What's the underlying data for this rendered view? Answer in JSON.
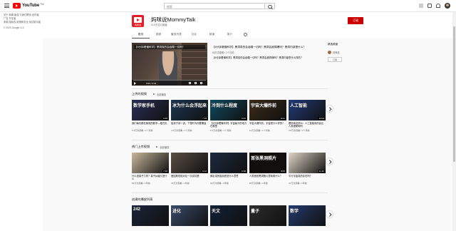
{
  "app": {
    "logo_text": "YouTube",
    "region": "TW"
  },
  "search": {
    "placeholder": "搜索"
  },
  "sidebar": {
    "links_text": "关于 新闻 版权 与我们联系 创作者 广告 开发者",
    "policy_text": "条款 隐私权 政策和安全 测试新功能",
    "copyright": "© 2020 Google LLC"
  },
  "channel": {
    "avatar_sub": "妈咪说",
    "name": "妈咪说MommyTalk",
    "subscribers": "11.5万位订阅者",
    "subscribe_label": "订阅"
  },
  "tabs": [
    "首页",
    "视频",
    "播放列表",
    "社区",
    "频道",
    "简介"
  ],
  "feature": {
    "thumb_title": "【6分钟看懂科学】黑洞真的会吞噬一切吗？",
    "time": "0:00 / 6:24",
    "progress": 0.0,
    "title": "【6分钟看懂科学】黑洞真的会吞噬一切吗？黑洞会被撑爆吗？黑洞内部是什么？",
    "meta": "65万次观看 • 1个月前",
    "desc": "【6分钟看懂科学】黑洞真的会吞噬一切吗？黑洞会被撑爆吗？黑洞内部是什么样的？"
  },
  "shelves": [
    {
      "title": "上传的视频",
      "play_all": "全部播放",
      "videos": [
        {
          "thumb": "数学家手机",
          "duration": "9:48",
          "title": "我们每天都在使用的数学—格式化",
          "meta": "5.4万次观看 • 1个月前",
          "bg": "#2a2f55"
        },
        {
          "thumb": "冰为什么会浮起来",
          "duration": "7:15",
          "title": "给孩子讲一讲，下雪时为何要撒盐",
          "meta": "4.2万次观看 • 1个月前",
          "bg": "#1d3552"
        },
        {
          "thumb": "冷到什么程度",
          "duration": "6:02",
          "title": "【3分钟看懂科学】宇宙最冷的地方在哪里",
          "meta": "6.4万次观看 • 1个月前",
          "bg": "#0e4a5e"
        },
        {
          "thumb": "宇宙大爆炸前",
          "duration": "8:21",
          "title": "宇宙大爆炸前，宇宙是什么样的？",
          "meta": "12万次观看 • 1个月前",
          "bg": "#3b2b18"
        },
        {
          "thumb": "人工智能",
          "duration": "10:04",
          "title": "跟妈咪说学AI：人工智能真的会比人类更聪明吗",
          "meta": "3.8万次观看 • 2个月前",
          "bg": "#223a78"
        }
      ]
    },
    {
      "title": "热门上传视频",
      "play_all": "全部播放",
      "videos": [
        {
          "thumb": "",
          "duration": "7:48",
          "title": "什么是量子力学？量子纠缠又是什么",
          "meta": "89万次观看 • 1年前",
          "bg": "#c9b89c"
        },
        {
          "thumb": "",
          "duration": "9:12",
          "title": "爱因斯坦相对论一次讲清楚",
          "meta": "76万次观看 • 1年前",
          "bg": "#5a4e44"
        },
        {
          "thumb": "",
          "duration": "6:38",
          "title": "薛定谔的猫到底是什么意思",
          "meta": "64万次观看 • 1年前",
          "bg": "#1d2a3f"
        },
        {
          "thumb": "首张黑洞照片",
          "duration": "8:05",
          "title": "人类首张黑洞照片意味着什么？",
          "meta": "58万次观看 • 1年前",
          "bg": "#120c08"
        },
        {
          "thumb": "",
          "duration": "11:20",
          "title": "平行宇宙真的存在吗？",
          "meta": "47万次观看 • 1年前",
          "bg": "#dfd6c7"
        }
      ]
    },
    {
      "title": "创建的播放列表",
      "play_all": "",
      "videos": [
        {
          "thumb": "242",
          "duration": "",
          "title": "",
          "meta": "",
          "bg": "#1a2338"
        },
        {
          "thumb": "进化",
          "duration": "",
          "title": "",
          "meta": "",
          "bg": "#3a4a6a"
        },
        {
          "thumb": "天文",
          "duration": "",
          "title": "",
          "meta": "",
          "bg": "#102035"
        },
        {
          "thumb": "量子",
          "duration": "",
          "title": "",
          "meta": "",
          "bg": "#2c2c2c"
        },
        {
          "thumb": "数学",
          "duration": "",
          "title": "",
          "meta": "",
          "bg": "#233b6e"
        }
      ]
    }
  ],
  "right_panel": {
    "title": "精选频道",
    "channel": "妈咪说",
    "sub_label": "订阅"
  },
  "colors": {
    "brand": "#ff0000",
    "subscribe": "#cc0000"
  }
}
